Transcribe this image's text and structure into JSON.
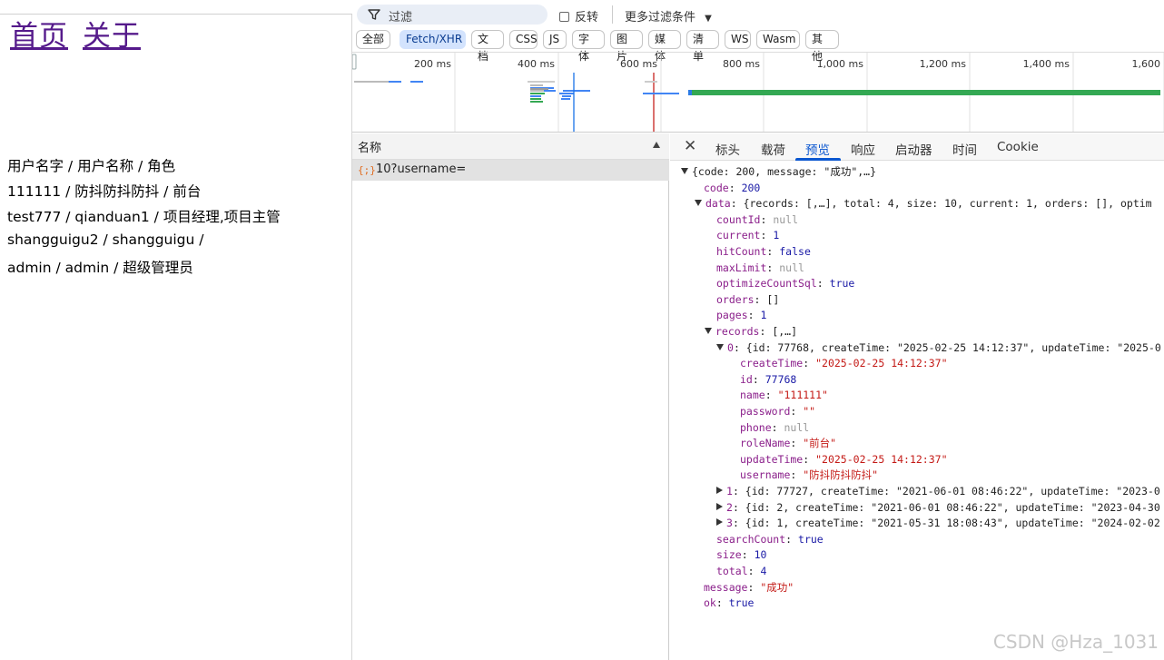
{
  "page": {
    "nav": [
      {
        "label": "首页"
      },
      {
        "label": "关于"
      }
    ],
    "users": [
      "用户名字 /  用户名称 /  角色",
      "111111 /  防抖防抖防抖 /  前台",
      "test777 /  qianduan1 /  项目经理,项目主管",
      "shangguigu2 /  shangguigu /",
      "admin /  admin /  超级管理员"
    ]
  },
  "devtools": {
    "filter_placeholder": "过滤",
    "invert_label": "反转",
    "more_filters_label": "更多过滤条件",
    "type_filters": [
      "全部",
      "Fetch/XHR",
      "文档",
      "CSS",
      "JS",
      "字体",
      "图片",
      "媒体",
      "清单",
      "WS",
      "Wasm",
      "其他"
    ],
    "active_type_filter": "Fetch/XHR",
    "timeline_ticks": [
      "200 ms",
      "400 ms",
      "600 ms",
      "800 ms",
      "1,000 ms",
      "1,200 ms",
      "1,400 ms",
      "1,600"
    ],
    "colors": {
      "long_request": "#34a853",
      "short_request": "#4285f4",
      "dom_content_loaded": "#1a73e8",
      "load_event": "#c5221f"
    },
    "request_list": {
      "column_header": "名称",
      "requests": [
        {
          "icon": "{;}",
          "name": "10?username="
        }
      ]
    },
    "detail_tabs": [
      "标头",
      "载荷",
      "预览",
      "响应",
      "启动器",
      "时间",
      "Cookie"
    ],
    "active_detail_tab": "预览",
    "preview_lines": [
      {
        "indent": 0,
        "tri": "down",
        "html": "{code: 200, message: \"成功\",…}"
      },
      {
        "indent": 1,
        "key": "code",
        "val": "200",
        "type": "n"
      },
      {
        "indent": 1,
        "tri": "down",
        "key": "data",
        "val": "{records: [,…], total: 4, size: 10, current: 1, orders: [], optim",
        "type": "raw"
      },
      {
        "indent": 2,
        "key": "countId",
        "val": "null",
        "type": "nl"
      },
      {
        "indent": 2,
        "key": "current",
        "val": "1",
        "type": "n"
      },
      {
        "indent": 2,
        "key": "hitCount",
        "val": "false",
        "type": "b"
      },
      {
        "indent": 2,
        "key": "maxLimit",
        "val": "null",
        "type": "nl"
      },
      {
        "indent": 2,
        "key": "optimizeCountSql",
        "val": "true",
        "type": "b"
      },
      {
        "indent": 2,
        "key": "orders",
        "val": "[]",
        "type": "raw"
      },
      {
        "indent": 2,
        "key": "pages",
        "val": "1",
        "type": "n"
      },
      {
        "indent": 2,
        "tri": "down",
        "key": "records",
        "val": "[,…]",
        "type": "raw"
      },
      {
        "indent": 3,
        "tri": "down",
        "key": "0",
        "val": "{id: 77768, createTime: \"2025-02-25 14:12:37\", updateTime: \"2025-0",
        "type": "raw"
      },
      {
        "indent": 4,
        "key": "createTime",
        "val": "\"2025-02-25 14:12:37\"",
        "type": "s"
      },
      {
        "indent": 4,
        "key": "id",
        "val": "77768",
        "type": "n"
      },
      {
        "indent": 4,
        "key": "name",
        "val": "\"111111\"",
        "type": "s"
      },
      {
        "indent": 4,
        "key": "password",
        "val": "\"\"",
        "type": "s"
      },
      {
        "indent": 4,
        "key": "phone",
        "val": "null",
        "type": "nl"
      },
      {
        "indent": 4,
        "key": "roleName",
        "val": "\"前台\"",
        "type": "s"
      },
      {
        "indent": 4,
        "key": "updateTime",
        "val": "\"2025-02-25 14:12:37\"",
        "type": "s"
      },
      {
        "indent": 4,
        "key": "username",
        "val": "\"防抖防抖防抖\"",
        "type": "s"
      },
      {
        "indent": 3,
        "tri": "right",
        "key": "1",
        "val": "{id: 77727, createTime: \"2021-06-01 08:46:22\", updateTime: \"2023-0",
        "type": "raw"
      },
      {
        "indent": 3,
        "tri": "right",
        "key": "2",
        "val": "{id: 2, createTime: \"2021-06-01 08:46:22\", updateTime: \"2023-04-30",
        "type": "raw"
      },
      {
        "indent": 3,
        "tri": "right",
        "key": "3",
        "val": "{id: 1, createTime: \"2021-05-31 18:08:43\", updateTime: \"2024-02-02",
        "type": "raw"
      },
      {
        "indent": 2,
        "key": "searchCount",
        "val": "true",
        "type": "b"
      },
      {
        "indent": 2,
        "key": "size",
        "val": "10",
        "type": "n"
      },
      {
        "indent": 2,
        "key": "total",
        "val": "4",
        "type": "n"
      },
      {
        "indent": 1,
        "key": "message",
        "val": "\"成功\"",
        "type": "s"
      },
      {
        "indent": 1,
        "key": "ok",
        "val": "true",
        "type": "b"
      }
    ]
  },
  "watermark": "CSDN @Hza_1031"
}
